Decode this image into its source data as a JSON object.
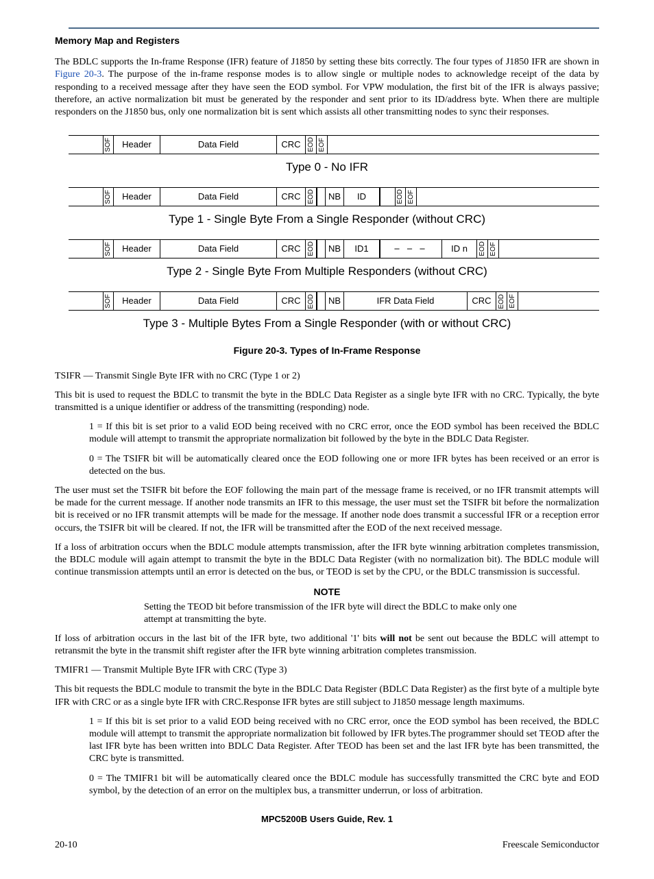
{
  "section_title": "Memory Map and Registers",
  "para_intro_a": "The BDLC supports the In-frame Response (IFR) feature of J1850 by setting these bits correctly. The four types of J1850 IFR are shown in ",
  "figure_link": "Figure 20-3",
  "para_intro_b": ". The purpose of the in-frame response modes is to allow single or multiple nodes to acknowledge receipt of the data by responding to a received message after they have seen the EOD symbol. For VPW modulation, the first bit of the IFR is always passive; therefore, an active normalization bit must be generated by the responder and sent prior to its ID/address byte. When there are multiple responders on the J1850 bus, only one normalization bit is sent which assists all other transmitting nodes to sync their responses.",
  "diagram": {
    "sof": "SOF",
    "header": "Header",
    "data": "Data Field",
    "crc": "CRC",
    "eod": "EOD",
    "eof": "EOF",
    "nb": "NB",
    "id": "ID",
    "id1": "ID1",
    "idn": "ID n",
    "ifr_data": "IFR Data Field",
    "type0": "Type 0 - No IFR",
    "type1": "Type 1 - Single Byte From a Single Responder (without CRC)",
    "type2": "Type 2 - Single Byte From Multiple Responders (without CRC)",
    "type3": "Type 3 - Multiple Bytes From a Single Responder (with or without CRC)"
  },
  "figure_caption": "Figure 20-3. Types of In-Frame Response",
  "tsifr_label": "TSIFR — Transmit Single Byte IFR with no CRC (Type 1 or 2)",
  "tsifr_p1": "This bit is used to request the BDLC to transmit the byte in the BDLC Data Register as a single byte IFR with no CRC. Typically, the byte transmitted is a unique identifier or address of the transmitting (responding) node.",
  "tsifr_1": "1 = If this bit is set prior to a valid EOD being received with no CRC error, once the EOD symbol has been received the BDLC module will attempt to transmit the appropriate normalization bit followed by the byte in the BDLC Data Register.",
  "tsifr_0": "0 = The TSIFR bit will be automatically cleared once the EOD following one or more IFR bytes has been received or an error is detected on the bus.",
  "para_user": "The user must set the TSIFR bit before the EOF following the main part of the message frame is received, or no IFR transmit attempts will be made for the current message. If another node transmits an IFR to this message, the user must set the TSIFR bit before the normalization bit is received or no IFR transmit attempts will be made for the message. If another node does transmit a successful IFR or a reception error occurs, the TSIFR bit will be cleared. If not, the IFR will be transmitted after the EOD of the next received message.",
  "para_arb": "If a loss of arbitration occurs when the BDLC module attempts transmission, after the IFR byte winning arbitration completes transmission, the BDLC module will again attempt to transmit the byte in the BDLC Data Register (with no normalization bit). The BDLC module will continue transmission attempts until an error is detected on the bus, or TEOD is set by the CPU, or the BDLC transmission is successful.",
  "note_label": "NOTE",
  "note_body": "Setting the TEOD bit before transmission of the IFR byte will direct the BDLC to make only one attempt at transmitting the byte.",
  "para_loss_a": "If loss of arbitration occurs in the last bit of the IFR byte, two additional '1' bits ",
  "will_not": "will not",
  "para_loss_b": " be sent out because the BDLC will attempt to retransmit the byte in the transmit shift register after the IFR byte winning arbitration completes transmission.",
  "tmifr_label": "TMIFR1 — Transmit Multiple Byte IFR with CRC (Type 3)",
  "tmifr_p1": "This bit requests the BDLC module to transmit the byte in the BDLC Data Register (BDLC Data Register) as the first byte of a multiple byte IFR with CRC or as a single byte IFR with CRC.Response IFR bytes are still subject to J1850 message length maximums.",
  "tmifr_1": "1 = If this bit is set prior to a valid EOD being received with no CRC error, once the EOD symbol has been received, the BDLC module will attempt to transmit the appropriate normalization bit followed by IFR bytes.The programmer should set TEOD after the last IFR byte has been written into BDLC Data Register. After TEOD has been set and the last IFR byte has been transmitted, the CRC byte is transmitted.",
  "tmifr_0": "0 = The TMIFR1 bit will be automatically cleared once the BDLC module has successfully transmitted the CRC byte and EOD symbol, by the detection of an error on the multiplex bus, a transmitter underrun, or loss of arbitration.",
  "footer_center": "MPC5200B Users Guide, Rev. 1",
  "footer_page": "20-10",
  "footer_vendor": "Freescale Semiconductor"
}
